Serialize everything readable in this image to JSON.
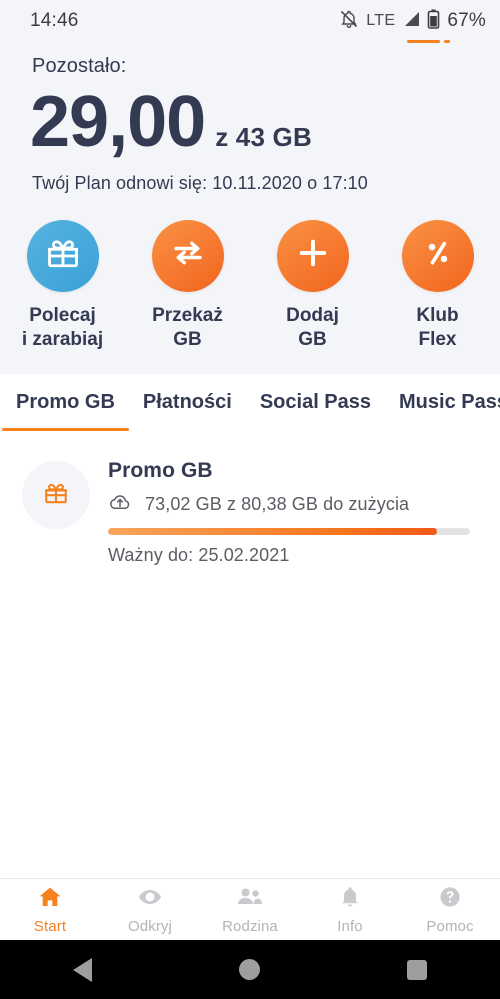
{
  "statusbar": {
    "time": "14:46",
    "network": "LTE",
    "battery_percent": "67%",
    "icons": {
      "bell_muted": "bell-muted-icon",
      "signal": "signal-icon",
      "battery": "battery-icon"
    }
  },
  "header": {
    "remaining_label": "Pozostało:",
    "amount": "29,00",
    "amount_unit": "z 43 GB",
    "renew_text": "Twój Plan odnowi się: 10.11.2020 o 17:10"
  },
  "quick_actions": [
    {
      "label_line1": "Polecaj",
      "label_line2": "i zarabiaj",
      "icon": "gift-icon",
      "color": "#3BA1D6"
    },
    {
      "label_line1": "Przekaż",
      "label_line2": "GB",
      "icon": "transfer-arrows-icon",
      "color": "#F2651E"
    },
    {
      "label_line1": "Dodaj",
      "label_line2": "GB",
      "icon": "plus-icon",
      "color": "#F2651E"
    },
    {
      "label_line1": "Klub",
      "label_line2": "Flex",
      "icon": "percent-icon",
      "color": "#F2651E"
    }
  ],
  "tabs": [
    {
      "label": "Promo GB",
      "active": true
    },
    {
      "label": "Płatności",
      "active": false
    },
    {
      "label": "Social Pass",
      "active": false
    },
    {
      "label": "Music Pass",
      "active": false
    }
  ],
  "promo": {
    "icon": "gift-icon",
    "title": "Promo GB",
    "usage_icon": "cloud-upload-icon",
    "usage_text": "73,02 GB z 80,38 GB do zużycia",
    "used_gb": 73.02,
    "total_gb": 80.38,
    "progress_percent": 91,
    "valid_text": "Ważny do: 25.02.2021"
  },
  "bottom_nav": [
    {
      "label": "Start",
      "icon": "home-icon",
      "active": true
    },
    {
      "label": "Odkryj",
      "icon": "eye-icon",
      "active": false
    },
    {
      "label": "Rodzina",
      "icon": "people-icon",
      "active": false
    },
    {
      "label": "Info",
      "icon": "bell-icon",
      "active": false
    },
    {
      "label": "Pomoc",
      "icon": "question-circle-icon",
      "active": false
    }
  ],
  "android_nav": {
    "back": "back-triangle-icon",
    "home": "home-circle-icon",
    "recents": "recents-square-icon"
  },
  "colors": {
    "accent_orange": "#F5811F",
    "accent_blue": "#3BA1D6",
    "text_dark": "#343A52",
    "panel_bg": "#F4F5F9"
  }
}
